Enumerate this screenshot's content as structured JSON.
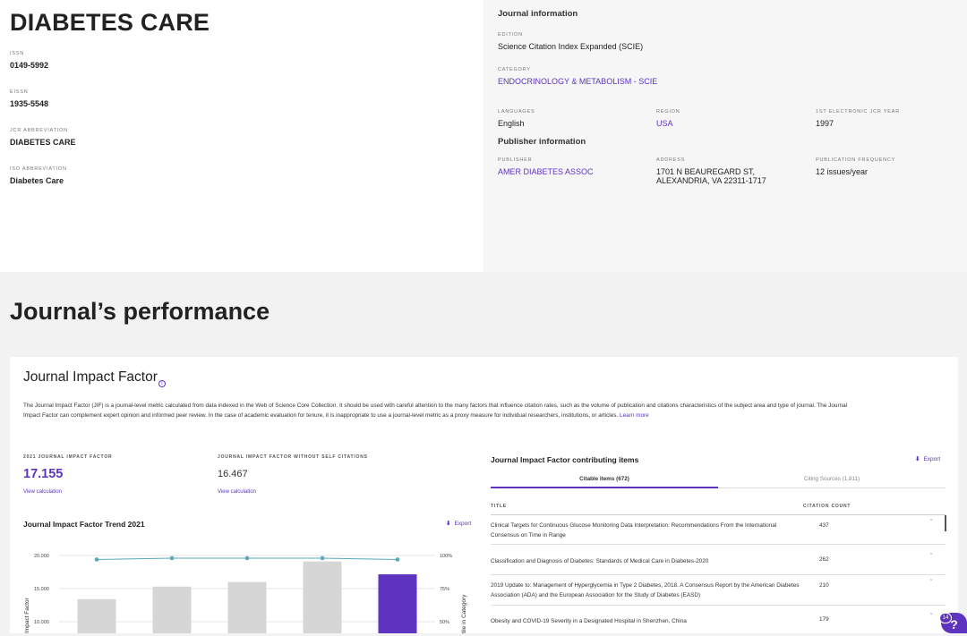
{
  "journal": {
    "title": "DIABETES CARE",
    "issn_label": "ISSN",
    "issn": "0149-5992",
    "eissn_label": "EISSN",
    "eissn": "1935-5548",
    "jcr_abbr_label": "JCR ABBREVIATION",
    "jcr_abbr": "DIABETES CARE",
    "iso_abbr_label": "ISO ABBREVIATION",
    "iso_abbr": "Diabetes Care"
  },
  "journal_info": {
    "heading": "Journal information",
    "edition_label": "EDITION",
    "edition": "Science Citation Index Expanded (SCIE)",
    "category_label": "CATEGORY",
    "category": "ENDOCRINOLOGY & METABOLISM - SCIE",
    "languages_label": "LANGUAGES",
    "languages": "English",
    "region_label": "REGION",
    "region": "USA",
    "first_year_label": "1ST ELECTRONIC JCR YEAR",
    "first_year": "1997"
  },
  "publisher_info": {
    "heading": "Publisher information",
    "publisher_label": "PUBLISHER",
    "publisher": "AMER DIABETES ASSOC",
    "address_label": "ADDRESS",
    "address_line1": "1701 N BEAUREGARD ST,",
    "address_line2": "ALEXANDRIA, VA 22311-1717",
    "frequency_label": "PUBLICATION FREQUENCY",
    "frequency": "12 issues/year"
  },
  "performance": {
    "heading": "Journal’s performance"
  },
  "jif": {
    "title": "Journal Impact Factor",
    "info_icon": "info-icon",
    "description": "The Journal Impact Factor (JIF) is a journal-level metric calculated from data indexed in the Web of Science Core Collection. It should be used with careful attention to the many factors that influence citation rates, such as the volume of publication and citations characteristics of the subject area and type of journal. The Journal Impact Factor can complement expert opinion and informed peer review. In the case of academic evaluation for tenure, it is inappropriate to use a journal-level metric as a proxy measure for individual researchers, institutions, or articles.",
    "learn_more": "Learn more",
    "jif_label": "2021 JOURNAL IMPACT FACTOR",
    "jif_value": "17.155",
    "jif_link": "View calculation",
    "no_self_label": "JOURNAL IMPACT FACTOR WITHOUT SELF CITATIONS",
    "no_self_value": "16.467",
    "no_self_link": "View calculation",
    "trend_title": "Journal Impact Factor Trend 2021",
    "export_label": "Export",
    "accent": "#5e33bf"
  },
  "chart_data": {
    "type": "bar",
    "title": "Journal Impact Factor Trend 2021",
    "ylabel": "Impact Factor",
    "y2label": "tile in Category",
    "ylim": [
      0,
      20
    ],
    "y_ticks": [
      "20.000",
      "15.000",
      "10.000"
    ],
    "y2_ticks": [
      "100%",
      "75%",
      "50%"
    ],
    "bar_values": [
      13.4,
      15.3,
      16.0,
      19.1,
      17.155
    ],
    "bar_colors": [
      "#d6d6d6",
      "#d6d6d6",
      "#d6d6d6",
      "#d6d6d6",
      "#5e33bf"
    ],
    "line_values_percent": [
      97,
      98,
      98,
      98,
      97
    ],
    "line_color": "#5aa9b8"
  },
  "contributing": {
    "title": "Journal Impact Factor contributing items",
    "export_label": "Export",
    "tab_citable": "Citable items (672)",
    "tab_citing": "Citing Sources (1,811)",
    "col_title": "TITLE",
    "col_count": "CITATION COUNT",
    "rows": [
      {
        "title": "Clinical Targets for Continuous Glucose Monitoring Data Interpretation: Recommendations From the International Consensus on Time in Range",
        "count": "437"
      },
      {
        "title": "Classification and Diagnosis of Diabetes: Standards of Medical Care in Diabetes-2020",
        "count": "262"
      },
      {
        "title": "2019 Update to: Management of Hyperglycemia in Type 2 Diabetes, 2018. A Consensus Report by the American Diabetes Association (ADA) and the European Association for the Study of Diabetes (EASD)",
        "count": "210"
      },
      {
        "title": "Obesity and COVID-19 Severity in a Designated Hospital in Shenzhen, China",
        "count": "179"
      }
    ]
  },
  "help": {
    "badge": "14",
    "glyph": "?"
  }
}
